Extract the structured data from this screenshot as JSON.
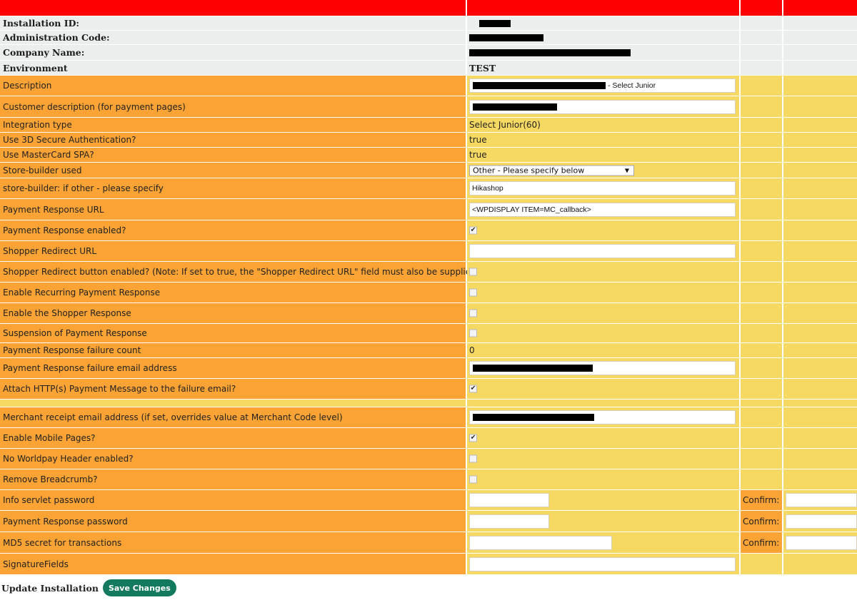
{
  "rows": {
    "installation_id": {
      "label": "Installation ID:",
      "value": ""
    },
    "administration_code": {
      "label": "Administration Code:",
      "value": ""
    },
    "company_name": {
      "label": "Company Name:",
      "value": ""
    },
    "environment": {
      "label": "Environment",
      "value": "TEST"
    },
    "description": {
      "label": "Description",
      "value_suffix": "- Select Junior"
    },
    "customer_description": {
      "label": "Customer description (for payment pages)"
    },
    "integration_type": {
      "label": "Integration type",
      "value": "Select Junior(60)"
    },
    "use_3d_secure": {
      "label": "Use 3D Secure Authentication?",
      "value": "true"
    },
    "use_mastercard_spa": {
      "label": "Use MasterCard SPA?",
      "value": "true"
    },
    "store_builder": {
      "label": "Store-builder used",
      "selected": "Other - Please specify below"
    },
    "store_builder_other": {
      "label": "store-builder: if other - please specify",
      "value": "Hikashop"
    },
    "payment_response_url": {
      "label": "Payment Response URL",
      "value": "<WPDISPLAY ITEM=MC_callback>"
    },
    "payment_response_enabled": {
      "label": "Payment Response enabled?",
      "checked": true
    },
    "shopper_redirect_url": {
      "label": "Shopper Redirect URL",
      "value": ""
    },
    "shopper_redirect_button": {
      "label": "Shopper Redirect button enabled? (Note: If set to true, the \"Shopper Redirect URL\" field must also be supplied)",
      "checked": false
    },
    "recurring_payment_response": {
      "label": "Enable Recurring Payment Response",
      "checked": false
    },
    "shopper_response": {
      "label": "Enable the Shopper Response",
      "checked": false
    },
    "suspension_payment_response": {
      "label": "Suspension of Payment Response",
      "checked": false
    },
    "failure_count": {
      "label": "Payment Response failure count",
      "value": "0"
    },
    "failure_email": {
      "label": "Payment Response failure email address"
    },
    "attach_http_message": {
      "label": "Attach HTTP(s) Payment Message to the failure email?",
      "checked": true
    },
    "merchant_receipt_email": {
      "label": "Merchant receipt email address (if set, overrides value at Merchant Code level)"
    },
    "enable_mobile_pages": {
      "label": "Enable Mobile Pages?",
      "checked": true
    },
    "no_worldpay_header": {
      "label": "No Worldpay Header enabled?",
      "checked": false
    },
    "remove_breadcrumb": {
      "label": "Remove Breadcrumb?",
      "checked": false
    },
    "info_servlet_password": {
      "label": "Info servlet password",
      "confirm": "Confirm:"
    },
    "payment_response_password": {
      "label": "Payment Response password",
      "confirm": "Confirm:"
    },
    "md5_secret": {
      "label": "MD5 secret for transactions",
      "confirm": "Confirm:"
    },
    "signature_fields": {
      "label": "SignatureFields",
      "value": ""
    }
  },
  "footer": {
    "label": "Update Installation",
    "button": "Save Changes"
  },
  "colors": {
    "header": "#ff0000",
    "label_bg": "#fba334",
    "value_bg": "#f6d963",
    "info_bg": "#eceeee",
    "button": "#137a5f"
  }
}
